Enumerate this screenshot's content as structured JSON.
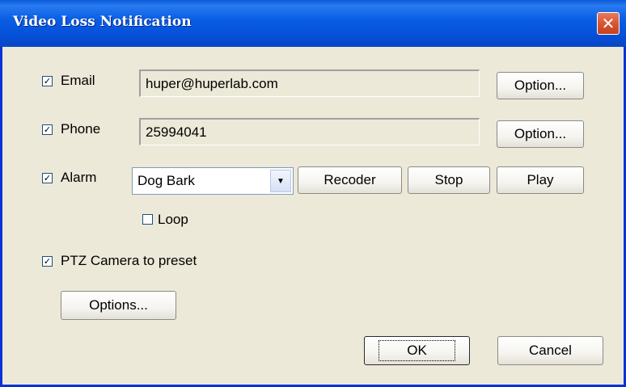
{
  "window": {
    "title": "Video Loss Notification",
    "close_glyph": "✕"
  },
  "email": {
    "label": "Email",
    "checked": true,
    "value": "huper@huperlab.com",
    "option_button": "Option..."
  },
  "phone": {
    "label": "Phone",
    "checked": true,
    "value": "25994041",
    "option_button": "Option..."
  },
  "alarm": {
    "label": "Alarm",
    "checked": true,
    "selected": "Dog Bark",
    "recorder_button": "Recoder",
    "stop_button": "Stop",
    "play_button": "Play",
    "loop_label": "Loop",
    "loop_checked": false
  },
  "ptz": {
    "label": "PTZ Camera to preset",
    "checked": true,
    "options_button": "Options..."
  },
  "footer": {
    "ok_button": "OK",
    "cancel_button": "Cancel"
  },
  "icons": {
    "check_glyph": "✓",
    "dropdown_glyph": "▼"
  },
  "colors": {
    "titlebar": "#0a5fe4",
    "dialog_bg": "#ece9d8",
    "close_button": "#d9522e"
  }
}
